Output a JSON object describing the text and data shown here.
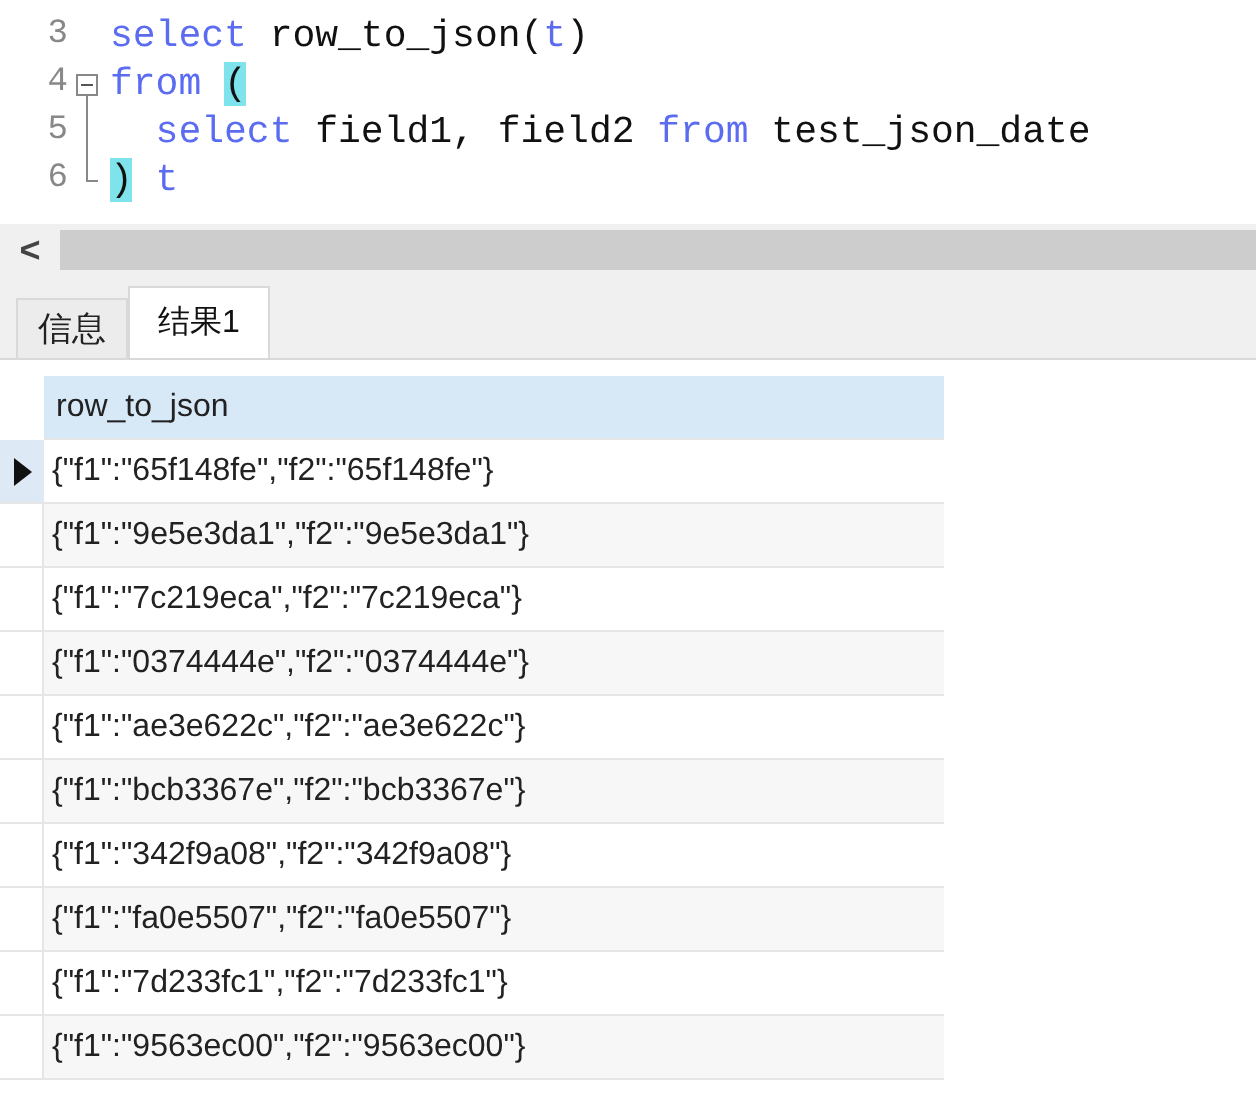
{
  "editor": {
    "lines": [
      {
        "number": "3",
        "kind": "plain",
        "tokens": [
          {
            "kind": "keyword",
            "text": "select"
          },
          {
            "kind": "plain",
            "text": " row_to_json("
          },
          {
            "kind": "keyword",
            "text": "t"
          },
          {
            "kind": "plain",
            "text": ")"
          }
        ]
      },
      {
        "number": "4",
        "kind": "foldstart",
        "tokens": [
          {
            "kind": "keyword",
            "text": "from "
          },
          {
            "kind": "match",
            "text": "("
          }
        ]
      },
      {
        "number": "5",
        "kind": "foldmiddle",
        "tokens": [
          {
            "kind": "keyword",
            "text": "  select"
          },
          {
            "kind": "plain",
            "text": " field1, field2 "
          },
          {
            "kind": "keyword",
            "text": "from"
          },
          {
            "kind": "plain",
            "text": " test_json_date"
          }
        ]
      },
      {
        "number": "6",
        "kind": "foldend",
        "tokens": [
          {
            "kind": "match",
            "text": ")"
          },
          {
            "kind": "keyword",
            "text": " t"
          }
        ]
      }
    ]
  },
  "scrollbar": {
    "arrow": "<"
  },
  "tabs": [
    {
      "label": "信息",
      "selected": false
    },
    {
      "label": "结果1",
      "selected": true
    }
  ],
  "table": {
    "columns": [
      "row_to_json"
    ],
    "rows": [
      {
        "cells": [
          "{\"f1\":\"65f148fe\",\"f2\":\"65f148fe\"}"
        ],
        "selected": true
      },
      {
        "cells": [
          "{\"f1\":\"9e5e3da1\",\"f2\":\"9e5e3da1\"}"
        ],
        "selected": false
      },
      {
        "cells": [
          "{\"f1\":\"7c219eca\",\"f2\":\"7c219eca\"}"
        ],
        "selected": false
      },
      {
        "cells": [
          "{\"f1\":\"0374444e\",\"f2\":\"0374444e\"}"
        ],
        "selected": false
      },
      {
        "cells": [
          "{\"f1\":\"ae3e622c\",\"f2\":\"ae3e622c\"}"
        ],
        "selected": false
      },
      {
        "cells": [
          "{\"f1\":\"bcb3367e\",\"f2\":\"bcb3367e\"}"
        ],
        "selected": false
      },
      {
        "cells": [
          "{\"f1\":\"342f9a08\",\"f2\":\"342f9a08\"}"
        ],
        "selected": false
      },
      {
        "cells": [
          "{\"f1\":\"fa0e5507\",\"f2\":\"fa0e5507\"}"
        ],
        "selected": false
      },
      {
        "cells": [
          "{\"f1\":\"7d233fc1\",\"f2\":\"7d233fc1\"}"
        ],
        "selected": false
      },
      {
        "cells": [
          "{\"f1\":\"9563ec00\",\"f2\":\"9563ec00\"}"
        ],
        "selected": false
      }
    ]
  }
}
